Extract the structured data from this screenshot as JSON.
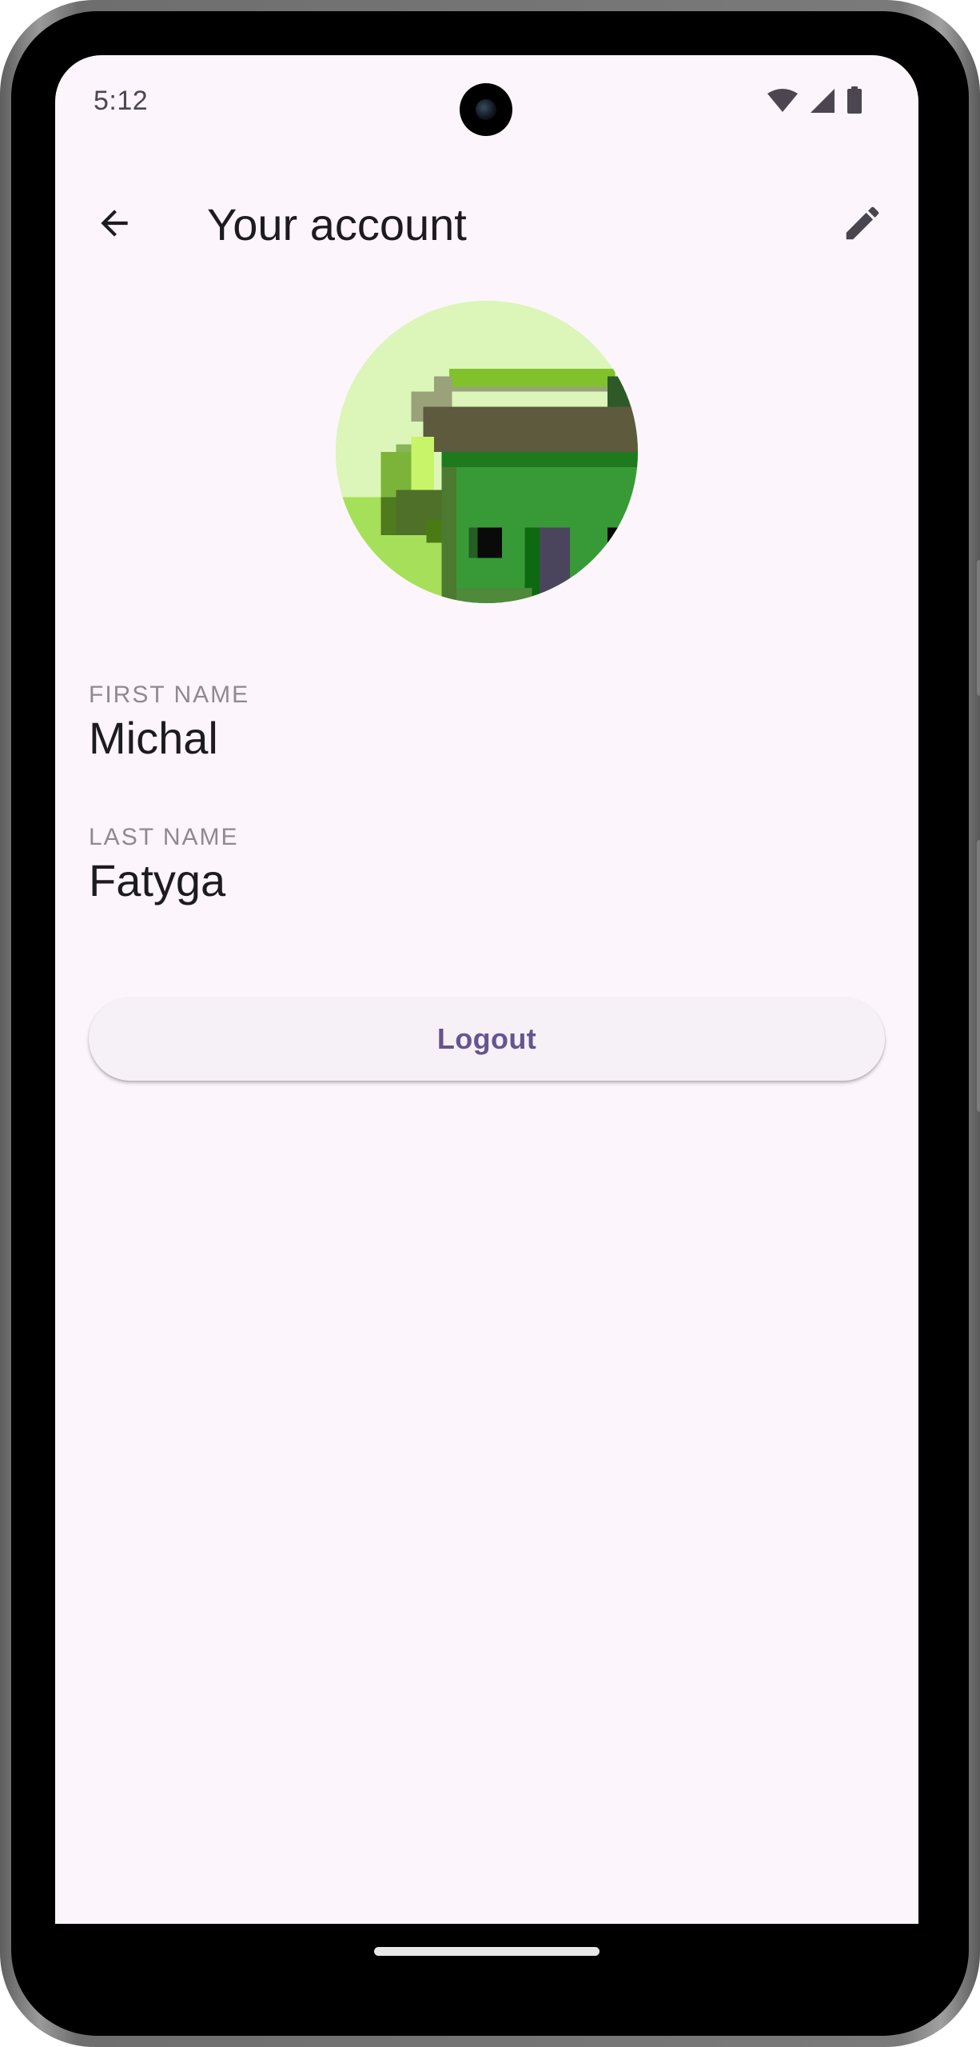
{
  "status_bar": {
    "time": "5:12",
    "icons": [
      "wifi-icon",
      "cellular-signal-icon",
      "battery-icon"
    ]
  },
  "top_bar": {
    "title": "Your account",
    "back_icon": "arrow-back-icon",
    "edit_icon": "edit-pencil-icon"
  },
  "profile": {
    "avatar_description": "pixel-art-avatar",
    "first_name": {
      "label": "FIRST NAME",
      "value": "Michal"
    },
    "last_name": {
      "label": "LAST NAME",
      "value": "Fatyga"
    }
  },
  "actions": {
    "logout_label": "Logout"
  },
  "colors": {
    "background": "#fcf5fb",
    "accent": "#65558f",
    "text_primary": "#1d1b20",
    "label": "#8d8a90"
  }
}
